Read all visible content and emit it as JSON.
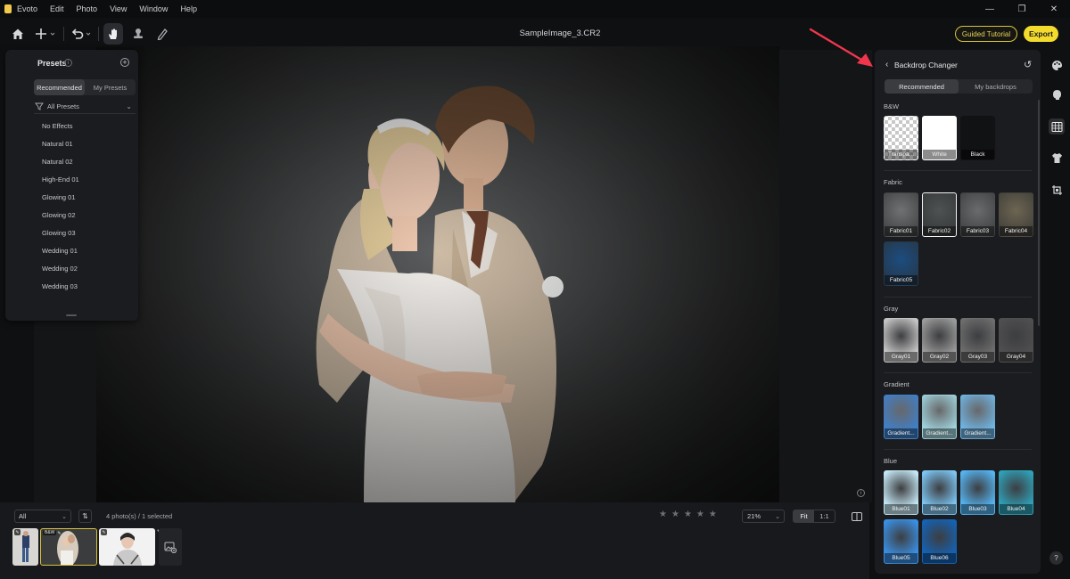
{
  "menu": [
    "Evoto",
    "Edit",
    "Photo",
    "View",
    "Window",
    "Help"
  ],
  "window_controls": [
    "—",
    "❐",
    "✕"
  ],
  "toolbar": {
    "doc_title": "SampleImage_3.CR2",
    "guided_label": "Guided Tutorial",
    "export_label": "Export"
  },
  "presets": {
    "title": "Presets",
    "info": "i",
    "add": "+",
    "tabs": [
      "Recommended",
      "My Presets"
    ],
    "filter": "All Presets",
    "items": [
      "No Effects",
      "Natural 01",
      "Natural 02",
      "High-End 01",
      "Glowing 01",
      "Glowing 02",
      "Glowing 03",
      "Wedding 01",
      "Wedding 02",
      "Wedding 03"
    ]
  },
  "canvas": {
    "info": "i"
  },
  "bottom": {
    "filter": "All",
    "count": "4 photo(s) / 1 selected",
    "rating": 0,
    "zoom": "21%",
    "fit": "Fit",
    "one_to_one": "1:1",
    "thumb_tag": "B&W"
  },
  "backdrop": {
    "title": "Backdrop Changer",
    "tabs": [
      "Recommended",
      "My backdrops"
    ],
    "sections": {
      "bw": {
        "label": "B&W",
        "items": [
          {
            "name": "Transpa...",
            "color": "#cfcfcf"
          },
          {
            "name": "White",
            "color": "#ffffff"
          },
          {
            "name": "Black",
            "color": "#111214"
          }
        ]
      },
      "fabric": {
        "label": "Fabric",
        "items": [
          {
            "name": "Fabric01",
            "color": "#6f7173"
          },
          {
            "name": "Fabric02",
            "color": "#4e5253"
          },
          {
            "name": "Fabric03",
            "color": "#6a6b6d"
          },
          {
            "name": "Fabric04",
            "color": "#6c6552"
          },
          {
            "name": "Fabric05",
            "color": "#1c4d80"
          }
        ]
      },
      "gray": {
        "label": "Gray",
        "items": [
          {
            "name": "Gray01",
            "color": "#c4c4c4"
          },
          {
            "name": "Gray02",
            "color": "#9a9a9a"
          },
          {
            "name": "Gray03",
            "color": "#6d6d6d"
          },
          {
            "name": "Gray04",
            "color": "#4f4f50"
          }
        ]
      },
      "gradient": {
        "label": "Gradient",
        "items": [
          {
            "name": "Gradient...",
            "color": "#3f7fc9"
          },
          {
            "name": "Gradient...",
            "color": "#9fd3dc"
          },
          {
            "name": "Gradient...",
            "color": "#6fb4e3"
          }
        ]
      },
      "blue": {
        "label": "Blue",
        "items": [
          {
            "name": "Blue01",
            "color": "#c3e6f3"
          },
          {
            "name": "Blue02",
            "color": "#7cc5f2"
          },
          {
            "name": "Blue03",
            "color": "#55b3f0"
          },
          {
            "name": "Blue04",
            "color": "#2fa0b8"
          },
          {
            "name": "Blue05",
            "color": "#3a8fe3"
          },
          {
            "name": "Blue06",
            "color": "#1462b4"
          }
        ]
      }
    }
  },
  "colors": {
    "accent": "#f2db2c",
    "annotation_arrow": "#f0364c"
  }
}
